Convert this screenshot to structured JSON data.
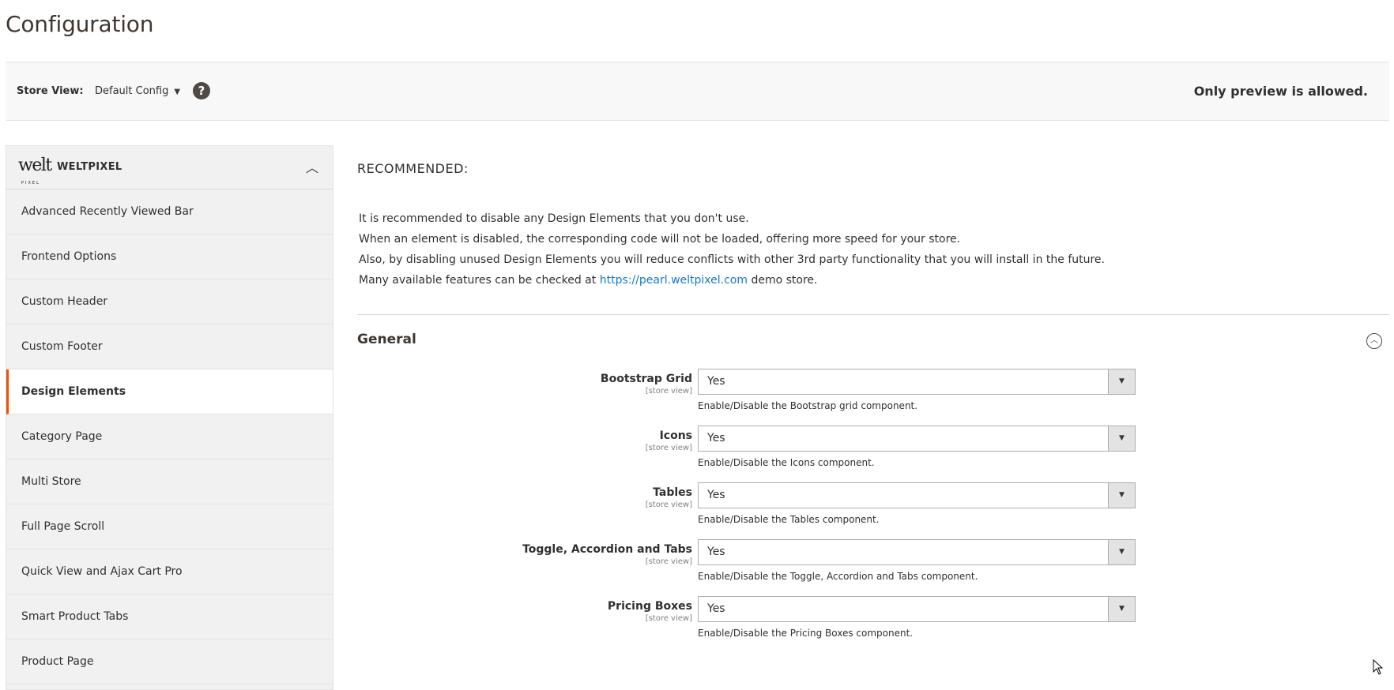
{
  "page_title": "Configuration",
  "store_bar": {
    "label": "Store View:",
    "value": "Default Config",
    "help": "?",
    "preview_message": "Only preview is allowed."
  },
  "sidebar": {
    "logo_text": "welt",
    "logo_sub": "PIXEL",
    "title": "WELTPIXEL",
    "items": [
      {
        "label": "Advanced Recently Viewed Bar"
      },
      {
        "label": "Frontend Options"
      },
      {
        "label": "Custom Header"
      },
      {
        "label": "Custom Footer"
      },
      {
        "label": "Design Elements",
        "active": true
      },
      {
        "label": "Category Page"
      },
      {
        "label": "Multi Store"
      },
      {
        "label": "Full Page Scroll"
      },
      {
        "label": "Quick View and Ajax Cart Pro"
      },
      {
        "label": "Smart Product Tabs"
      },
      {
        "label": "Product Page"
      }
    ]
  },
  "main": {
    "recommended_title": "RECOMMENDED:",
    "lines": [
      "It is recommended to disable any Design Elements that you don't use.",
      "When an element is disabled, the corresponding code will not be loaded, offering more speed for your store.",
      "Also, by disabling unused Design Elements you will reduce conflicts with other 3rd party functionality that you will install in the future."
    ],
    "last_line_prefix": "Many available features can be checked at ",
    "link_text": "https://pearl.weltpixel.com",
    "last_line_suffix": " demo store.",
    "section_title": "General",
    "fields": [
      {
        "label": "Bootstrap Grid",
        "scope": "[store view]",
        "value": "Yes",
        "note": "Enable/Disable the Bootstrap grid component."
      },
      {
        "label": "Icons",
        "scope": "[store view]",
        "value": "Yes",
        "note": "Enable/Disable the Icons component."
      },
      {
        "label": "Tables",
        "scope": "[store view]",
        "value": "Yes",
        "note": "Enable/Disable the Tables component."
      },
      {
        "label": "Toggle, Accordion and Tabs",
        "scope": "[store view]",
        "value": "Yes",
        "note": "Enable/Disable the Toggle, Accordion and Tabs component."
      },
      {
        "label": "Pricing Boxes",
        "scope": "[store view]",
        "value": "Yes",
        "note": "Enable/Disable the Pricing Boxes component."
      }
    ]
  }
}
